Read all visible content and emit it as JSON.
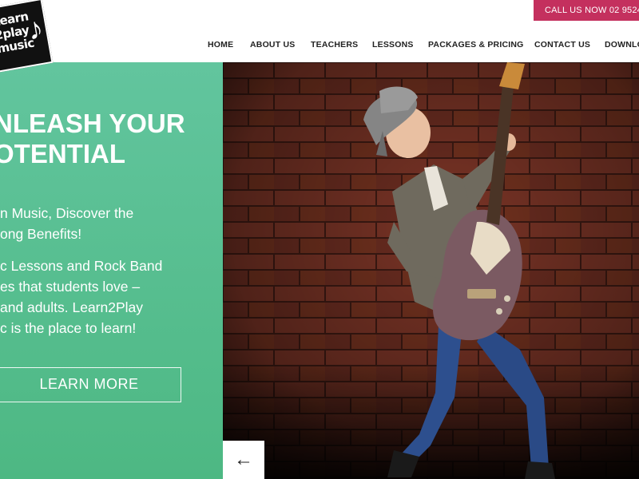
{
  "header": {
    "logo": {
      "line1": "Learn",
      "line2": "2play",
      "line3": "music",
      "note_glyph": "♪"
    },
    "call_button": "CALL US NOW 02 9524",
    "nav": [
      "HOME",
      "ABOUT US",
      "TEACHERS",
      "LESSONS",
      "PACKAGES & PRICING",
      "CONTACT US",
      "DOWNLOADS"
    ]
  },
  "hero": {
    "headline_line1": "NLEASH YOUR",
    "headline_line2": "OTENTIAL",
    "para1_line1": "n Music, Discover the",
    "para1_line2": "ong Benefits!",
    "para2_line1": "c Lessons and Rock Band",
    "para2_line2": "es that students love –",
    "para2_line3": "and adults. Learn2Play",
    "para2_line4": "c is the place to learn!",
    "cta_label": "LEARN MORE",
    "prev_arrow_glyph": "←"
  },
  "colors": {
    "accent_pink": "#c4305e",
    "hero_green": "#5bc193",
    "brick": "#6e2f22",
    "nav_text": "#222222"
  },
  "icons": [
    "music-note-icon",
    "arrow-left-icon"
  ]
}
